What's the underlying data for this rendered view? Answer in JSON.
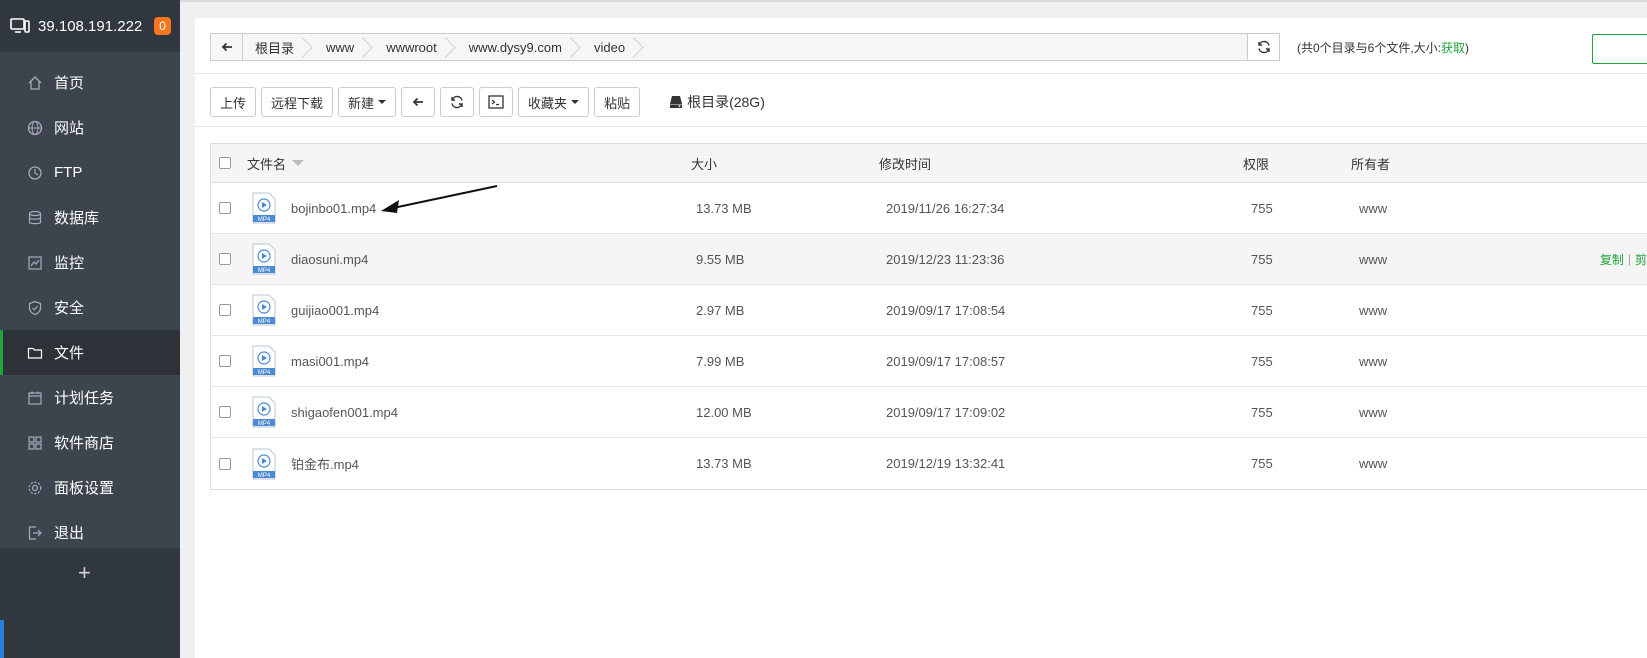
{
  "server": {
    "ip": "39.108.191.222",
    "badge": "0"
  },
  "sidebar": {
    "items": [
      {
        "label": "首页",
        "icon": "home-icon"
      },
      {
        "label": "网站",
        "icon": "globe-icon"
      },
      {
        "label": "FTP",
        "icon": "ftp-icon"
      },
      {
        "label": "数据库",
        "icon": "database-icon"
      },
      {
        "label": "监控",
        "icon": "monitor-icon"
      },
      {
        "label": "安全",
        "icon": "shield-icon"
      },
      {
        "label": "文件",
        "icon": "folder-icon",
        "active": true
      },
      {
        "label": "计划任务",
        "icon": "calendar-icon"
      },
      {
        "label": "软件商店",
        "icon": "grid-icon"
      },
      {
        "label": "面板设置",
        "icon": "gear-icon"
      },
      {
        "label": "退出",
        "icon": "logout-icon"
      }
    ],
    "add_label": "+"
  },
  "path": {
    "crumbs": [
      "根目录",
      "www",
      "wwwroot",
      "www.dysy9.com",
      "video"
    ],
    "summary": "(共0个目录与6个文件,大小:",
    "fetch": "获取",
    "summary_end": ")"
  },
  "toolbar": {
    "upload": "上传",
    "remote_download": "远程下载",
    "new": "新建",
    "favorites": "收藏夹",
    "paste": "粘贴",
    "disk": "根目录(28G)"
  },
  "table": {
    "headers": {
      "name": "文件名",
      "size": "大小",
      "mtime": "修改时间",
      "perm": "权限",
      "owner": "所有者"
    },
    "rows": [
      {
        "name": "bojinbo01.mp4",
        "size": "13.73 MB",
        "mtime": "2019/11/26 16:27:34",
        "perm": "755",
        "owner": "www"
      },
      {
        "name": "diaosuni.mp4",
        "size": "9.55 MB",
        "mtime": "2019/12/23 11:23:36",
        "perm": "755",
        "owner": "www"
      },
      {
        "name": "guijiao001.mp4",
        "size": "2.97 MB",
        "mtime": "2019/09/17 17:08:54",
        "perm": "755",
        "owner": "www"
      },
      {
        "name": "masi001.mp4",
        "size": "7.99 MB",
        "mtime": "2019/09/17 17:08:57",
        "perm": "755",
        "owner": "www"
      },
      {
        "name": "shigaofen001.mp4",
        "size": "12.00 MB",
        "mtime": "2019/09/17 17:09:02",
        "perm": "755",
        "owner": "www"
      },
      {
        "name": "铂金布.mp4",
        "size": "13.73 MB",
        "mtime": "2019/12/19 13:32:41",
        "perm": "755",
        "owner": "www"
      }
    ],
    "row_ops": {
      "copy": "复制",
      "sep": "|",
      "cut": "剪"
    },
    "file_badge": "MP4"
  },
  "colors": {
    "accent": "#20a53a",
    "sidebar": "#3c444d",
    "badge": "#f7761f"
  }
}
